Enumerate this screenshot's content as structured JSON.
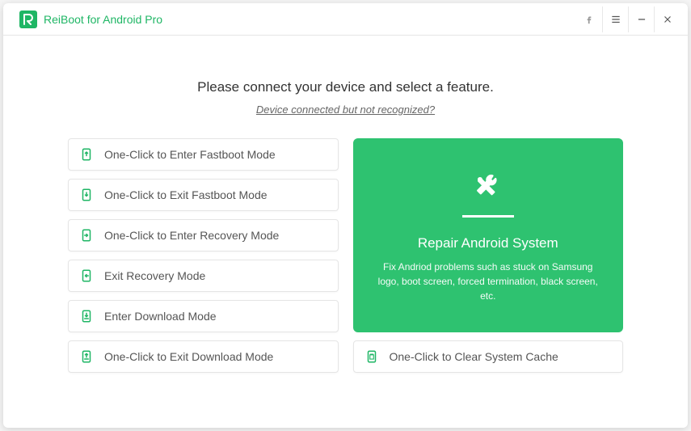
{
  "app": {
    "title": "ReiBoot for Android Pro"
  },
  "header": {
    "prompt": "Please connect your device and select a feature.",
    "help_link": "Device connected but not recognized?"
  },
  "features": {
    "enter_fastboot": "One-Click to Enter Fastboot Mode",
    "exit_fastboot": "One-Click to Exit Fastboot Mode",
    "enter_recovery": "One-Click to Enter Recovery Mode",
    "exit_recovery": "Exit Recovery Mode",
    "enter_download": "Enter Download Mode",
    "exit_download": "One-Click to Exit Download Mode",
    "clear_cache": "One-Click to Clear System Cache"
  },
  "repair": {
    "title": "Repair Android System",
    "desc": "Fix Andriod problems such as stuck on Samsung logo, boot screen, forced termination, black screen, etc."
  },
  "colors": {
    "brand": "#1fb665",
    "accent": "#2ec270"
  }
}
